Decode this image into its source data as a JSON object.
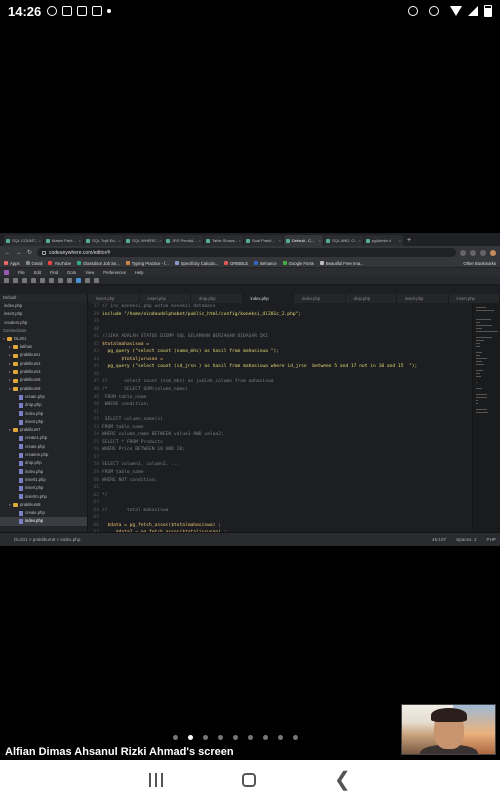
{
  "statusbar": {
    "time": "14:26"
  },
  "browser": {
    "tabs": [
      "SQL COUNT...",
      "Materi Perk...",
      "SQL Tryit Ed...",
      "SQL WHERE...",
      "JRS Pendid...",
      "Table Shows...",
      "Soal Prakti...",
      "Default - C...",
      "SQL AND, O...",
      "pgAdmin 4"
    ],
    "active_tab_index": 7,
    "url": "codeanywhere.com/editor/#",
    "bookmarks": [
      "Apps",
      "Gmail",
      "YouTube",
      "Glassdoor Job Se...",
      "Typing Practice - f...",
      "Specificity Calcula...",
      "DRIBBLE",
      "Behance",
      "Google Fonts",
      "Beautiful Free Ima..."
    ],
    "other_bookmarks": "Other Bookmarks"
  },
  "ide": {
    "menu": [
      "File",
      "Edit",
      "Find",
      "Goto",
      "View",
      "Preferences",
      "Help"
    ],
    "sidebar_header": "Default",
    "sidebar_items": [
      {
        "label": "index.php",
        "type": "file",
        "indent": 0
      },
      {
        "label": "insert.php",
        "type": "file",
        "indent": 0
      },
      {
        "label": "createm.php",
        "type": "file",
        "indent": 0
      }
    ],
    "connections_label": "Connections",
    "tree": [
      {
        "label": "DL201",
        "type": "folder",
        "indent": 0,
        "arrow": "▾"
      },
      {
        "label": "latihan",
        "type": "folder",
        "indent": 1,
        "arrow": "▸"
      },
      {
        "label": "praktikum1",
        "type": "folder",
        "indent": 1,
        "arrow": "▸"
      },
      {
        "label": "praktikum2",
        "type": "folder",
        "indent": 1,
        "arrow": "▸"
      },
      {
        "label": "praktikum3",
        "type": "folder",
        "indent": 1,
        "arrow": "▸"
      },
      {
        "label": "praktikum5",
        "type": "folder",
        "indent": 1,
        "arrow": "▸"
      },
      {
        "label": "praktikum6",
        "type": "folder",
        "indent": 1,
        "arrow": "▾"
      },
      {
        "label": "create.php",
        "type": "file",
        "indent": 2
      },
      {
        "label": "drop.php",
        "type": "file",
        "indent": 2
      },
      {
        "label": "index.php",
        "type": "file",
        "indent": 2
      },
      {
        "label": "insert.php",
        "type": "file",
        "indent": 2
      },
      {
        "label": "praktikum7",
        "type": "folder",
        "indent": 1,
        "arrow": "▾"
      },
      {
        "label": "create1.php",
        "type": "file",
        "indent": 2
      },
      {
        "label": "create.php",
        "type": "file",
        "indent": 2
      },
      {
        "label": "createm.php",
        "type": "file",
        "indent": 2
      },
      {
        "label": "drop.php",
        "type": "file",
        "indent": 2
      },
      {
        "label": "index.php",
        "type": "file",
        "indent": 2
      },
      {
        "label": "insert1.php",
        "type": "file",
        "indent": 2
      },
      {
        "label": "insert.php",
        "type": "file",
        "indent": 2
      },
      {
        "label": "insertm.php",
        "type": "file",
        "indent": 2
      },
      {
        "label": "praktikum8",
        "type": "folder",
        "indent": 1,
        "arrow": "▾"
      },
      {
        "label": "create.php",
        "type": "file",
        "indent": 2
      },
      {
        "label": "index.php",
        "type": "file",
        "indent": 2,
        "selected": true
      }
    ],
    "editor_tabs": [
      "insert.php",
      "insert.php",
      "drop.php",
      "index.php",
      "index.php",
      "drop.php",
      "insert.php",
      "insert.php"
    ],
    "active_editor_tab": 3,
    "code_lines": [
      {
        "n": "37",
        "t": "// inc_koneksi.php untuk koneksi database",
        "k": "cmt"
      },
      {
        "n": "38",
        "t": "include \"/home/eindaudelphobet/public_html/config/koneksi_dl201c_2.php\";",
        "k": "str"
      },
      {
        "n": "39",
        "t": "",
        "k": ""
      },
      {
        "n": "40",
        "t": "",
        "k": ""
      },
      {
        "n": "41",
        "t": "//JIKA ADALAH STATUS DIEMP SQL SELAMAAN BERJAKAN DIDASAR IKI",
        "k": "cmt"
      },
      {
        "n": "42",
        "t": "$totalmahasiswa =",
        "k": "var"
      },
      {
        "n": "43",
        "t": "  pg_query (\"select count (nama_mhs) as hasil from mahasiswa \");",
        "k": "str"
      },
      {
        "n": "44",
        "t": "       $totaljurusan =",
        "k": "var"
      },
      {
        "n": "45",
        "t": "  pg_query (\"select count (id_jrsn ) as hasil from mahasiswa where id_jrsn  between 5 and 17 not in 10 and 15  \");",
        "k": "str"
      },
      {
        "n": "46",
        "t": "",
        "k": ""
      },
      {
        "n": "47",
        "t": "//      select count (nim_mhs) as jumlah_column from mahasiswa",
        "k": "cmt"
      },
      {
        "n": "48",
        "t": "/*      SELECT SUM(column_name)",
        "k": "cmt"
      },
      {
        "n": "49",
        "t": " FROM table_name",
        "k": "cmt"
      },
      {
        "n": "50",
        "t": " WHERE condition;",
        "k": "cmt"
      },
      {
        "n": "51",
        "t": "",
        "k": ""
      },
      {
        "n": "52",
        "t": " SELECT column_name(s)",
        "k": "cmt"
      },
      {
        "n": "53",
        "t": "FROM table_name",
        "k": "cmt"
      },
      {
        "n": "54",
        "t": "WHERE column_name BETWEEN value1 AND value2;",
        "k": "cmt"
      },
      {
        "n": "55",
        "t": "SELECT * FROM Products",
        "k": "cmt"
      },
      {
        "n": "56",
        "t": "WHERE Price BETWEEN 10 AND 20;",
        "k": "cmt"
      },
      {
        "n": "57",
        "t": "",
        "k": ""
      },
      {
        "n": "58",
        "t": "SELECT column1, column2, ...",
        "k": "cmt"
      },
      {
        "n": "59",
        "t": "FROM table_name",
        "k": "cmt"
      },
      {
        "n": "60",
        "t": "WHERE NOT condition;",
        "k": "cmt"
      },
      {
        "n": "61",
        "t": "",
        "k": ""
      },
      {
        "n": "62",
        "t": "*/",
        "k": "cmt"
      },
      {
        "n": "63",
        "t": "",
        "k": ""
      },
      {
        "n": "64",
        "t": "//       total mahasiswa",
        "k": "cmt"
      },
      {
        "n": "65",
        "t": "",
        "k": ""
      },
      {
        "n": "66",
        "t": "  $data = pg_fetch_assoc($totalmahasiswa) ;",
        "k": "var"
      },
      {
        "n": "67",
        "t": "     $data2 = pg_fetch_assoc($totaljurusan) ;",
        "k": "var"
      },
      {
        "n": "68",
        "t": "     ?>",
        "k": ""
      },
      {
        "n": "69",
        "t": "     <tr>",
        "k": "html"
      },
      {
        "n": "70",
        "t": "",
        "k": ""
      },
      {
        "n": "71",
        "t": "       <td><?php echo $data ['hasil'];?></td>",
        "k": "html"
      },
      {
        "n": "72",
        "t": "       <td><?php echo $data2 ['hasil'];?></td>",
        "k": "html"
      }
    ],
    "status_path": "DL201 > praktikum8 > index.php",
    "status_cursor": "45:107",
    "status_spaces": "Spaces: 2",
    "status_lang": "PHP"
  },
  "caption": "Alfian Dimas Ahsanul Rizki Ahmad's screen",
  "pager": {
    "count": 9,
    "active": 1
  }
}
